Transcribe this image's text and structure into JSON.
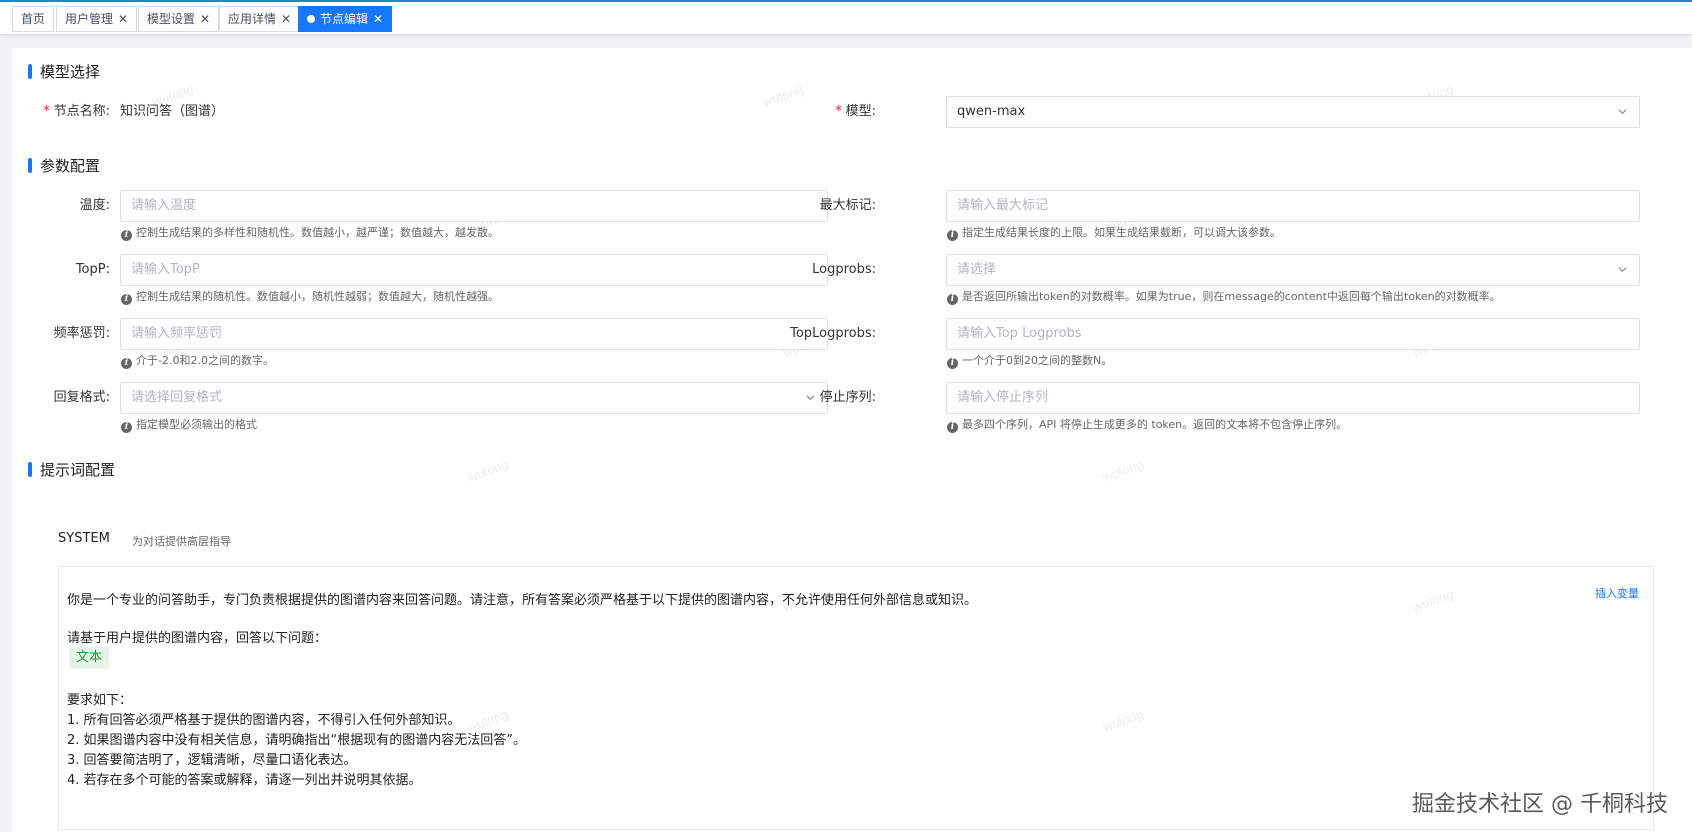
{
  "tabs": [
    {
      "label": "首页",
      "closable": false,
      "active": false
    },
    {
      "label": "用户管理",
      "closable": true,
      "active": false
    },
    {
      "label": "模型设置",
      "closable": true,
      "active": false
    },
    {
      "label": "应用详情",
      "closable": true,
      "active": false
    },
    {
      "label": "节点编辑",
      "closable": true,
      "active": true
    }
  ],
  "close_glyph": "✕",
  "sections": {
    "model": "模型选择",
    "params": "参数配置",
    "prompt": "提示词配置"
  },
  "node": {
    "label": "节点名称:",
    "value": "知识问答（图谱）"
  },
  "model": {
    "label": "模型:",
    "value": "qwen-max"
  },
  "params": {
    "temperature": {
      "label": "温度:",
      "placeholder": "请输入温度",
      "help": "控制生成结果的多样性和随机性。数值越小，越严谨；数值越大，越发散。"
    },
    "max_tokens": {
      "label": "最大标记:",
      "placeholder": "请输入最大标记",
      "help": "指定生成结果长度的上限。如果生成结果截断，可以调大该参数。"
    },
    "top_p": {
      "label": "TopP:",
      "placeholder": "请输入TopP",
      "help": "控制生成结果的随机性。数值越小，随机性越弱；数值越大，随机性越强。"
    },
    "logprobs": {
      "label": "Logprobs:",
      "placeholder": "请选择",
      "help": "是否返回所输出token的对数概率。如果为true，则在message的content中返回每个输出token的对数概率。"
    },
    "frequency_penalty": {
      "label": "频率惩罚:",
      "placeholder": "请输入频率惩罚",
      "help": "介于-2.0和2.0之间的数字。"
    },
    "top_logprobs": {
      "label": "TopLogprobs:",
      "placeholder": "请输入Top Logprobs",
      "help": "一个介于0到20之间的整数N。"
    },
    "response_format": {
      "label": "回复格式:",
      "placeholder": "请选择回复格式",
      "help": "指定模型必须输出的格式"
    },
    "stop": {
      "label": "停止序列:",
      "placeholder": "请输入停止序列",
      "help": "最多四个序列，API 将停止生成更多的 token。返回的文本将不包含停止序列。"
    }
  },
  "prompt": {
    "role": "SYSTEM",
    "role_desc": "为对话提供高层指导",
    "insert_variable": "插入变量",
    "line1": "你是一个专业的问答助手，专门负责根据提供的图谱内容来回答问题。请注意，所有答案必须严格基于以下提供的图谱内容，不允许使用任何外部信息或知识。",
    "line2": "请基于用户提供的图谱内容，回答以下问题：",
    "variable_tag": "文本",
    "requirements_title": "要求如下：",
    "req1": "1. 所有回答必须严格基于提供的图谱内容，不得引入任何外部知识。",
    "req2": "2. 如果图谱内容中没有相关信息，请明确指出“根据现有的图谱内容无法回答”。",
    "req3": "3. 回答要简洁明了，逻辑清晰，尽量口语化表达。",
    "req4": "4. 若存在多个可能的答案或解释，请逐一列出并说明其依据。"
  },
  "watermark_text": "wutong",
  "brand": "掘金技术社区 @ 千桐科技",
  "colors": {
    "primary": "#1677ff",
    "required": "#f5222d",
    "tag_bg": "#e6f4ea",
    "tag_text": "#1e9a3a"
  }
}
